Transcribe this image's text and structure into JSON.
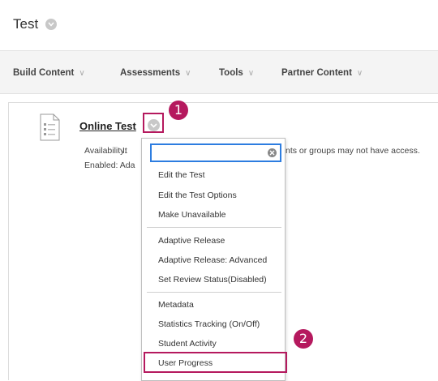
{
  "header": {
    "title": "Test"
  },
  "toolbar": {
    "items": [
      {
        "label": "Build Content"
      },
      {
        "label": "Assessments"
      },
      {
        "label": "Tools"
      },
      {
        "label": "Partner Content"
      }
    ]
  },
  "content_item": {
    "title": "Online Test",
    "availability_label": "Availability:",
    "availability_text_start": "It",
    "availability_text_end": "nts or groups may not have access.",
    "enabled_label": "Enabled:",
    "enabled_text": "Ada"
  },
  "context_menu": {
    "search_value": "",
    "groups": [
      [
        "Edit the Test",
        "Edit the Test Options",
        "Make Unavailable"
      ],
      [
        "Adaptive Release",
        "Adaptive Release: Advanced",
        "Set Review Status(Disabled)"
      ],
      [
        "Metadata",
        "Statistics Tracking (On/Off)",
        "Student Activity",
        "User Progress"
      ]
    ]
  },
  "callouts": {
    "step1": "1",
    "step2": "2"
  },
  "colors": {
    "callout": "#b5195e",
    "search_focus": "#2d7de0"
  }
}
